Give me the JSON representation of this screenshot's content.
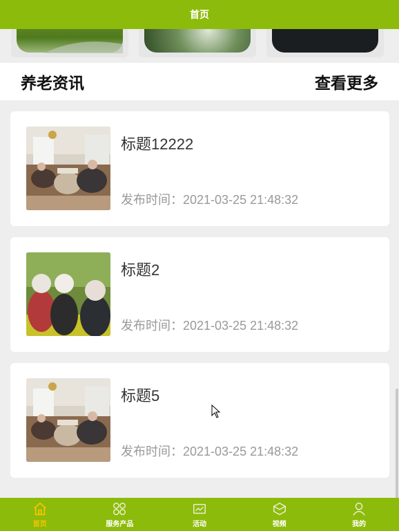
{
  "header": {
    "title": "首页"
  },
  "section": {
    "title": "养老资讯",
    "more_label": "查看更多"
  },
  "news": [
    {
      "title": "标题12222",
      "time": "发布时间：2021-03-25 21:48:32",
      "image": "elderly-dining-room-photo"
    },
    {
      "title": "标题2",
      "time": "发布时间：2021-03-25 21:48:32",
      "image": "elderly-group-outdoor-photo"
    },
    {
      "title": "标题5",
      "time": "发布时间：2021-03-25 21:48:32",
      "image": "elderly-dining-room-photo"
    }
  ],
  "tabbar": {
    "items": [
      {
        "label": "首页",
        "icon": "home-icon",
        "active": true
      },
      {
        "label": "服务产品",
        "icon": "grid-icon",
        "active": false
      },
      {
        "label": "活动",
        "icon": "activity-icon",
        "active": false
      },
      {
        "label": "视频",
        "icon": "video-icon",
        "active": false
      },
      {
        "label": "我的",
        "icon": "user-icon",
        "active": false
      }
    ]
  },
  "colors": {
    "brand": "#8dbb0b",
    "active_tab": "#f6c400",
    "time_text": "#999999"
  }
}
